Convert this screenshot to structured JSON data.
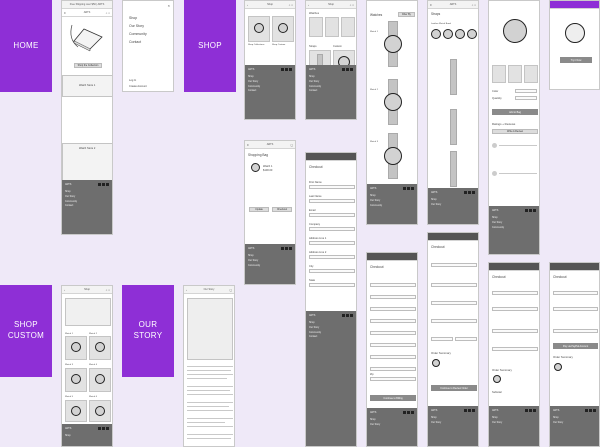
{
  "sections": {
    "home": "HOME",
    "shop": "SHOP",
    "shop_custom": "SHOP\nCUSTOM",
    "our_story": "OUR\nSTORY"
  },
  "nav_menu": [
    "Shop",
    "Our Story",
    "Community",
    "Contact"
  ],
  "footer_links": [
    "Shop",
    "Our Story",
    "Community",
    "Contact"
  ],
  "screens": {
    "home": {
      "header": "Free Shipping over $50 | ARTS",
      "cta": "Shop the Collection",
      "watch_text": "Watch Store 1",
      "watch_text2": "Watch Store 2",
      "login": "Log In",
      "create": "Create Account"
    },
    "shop": {
      "title": "Shop",
      "items": [
        "Shop Collections",
        "Shop Custom"
      ],
      "subitems": [
        "Watches",
        "Straps",
        "Custom"
      ]
    },
    "cart": {
      "title": "Shopping Bag",
      "item": "Watch 1",
      "price": "$100.00",
      "btn1": "Update",
      "btn2": "Checkout"
    },
    "watches": {
      "title": "Watches",
      "filter": "Filter By",
      "items": [
        "Watch 1",
        "Watch 2",
        "Watch 3"
      ]
    },
    "straps": {
      "title": "Straps",
      "subtitle": "Leather Watch Band"
    },
    "product": {
      "title": "Watch 1",
      "price": "$100.00",
      "labels": [
        "Color",
        "Quantity"
      ],
      "btn": "Add to Bag",
      "reviews": "Ratings + Reviews",
      "review_btn": "Write A Review"
    },
    "checkout": {
      "title": "Checkout",
      "fields": [
        "First Name",
        "Last Name",
        "Email",
        "Company",
        "Address Line 1",
        "Address Line 2",
        "City",
        "State",
        "Zip"
      ],
      "btn": "Continue to Billing",
      "order_summary": "Order Summary",
      "subtotal": "Subtotal",
      "pay_btn": "Continue to Review Order",
      "paypal": "Pay via PayPal Account"
    },
    "custom": {
      "title": "Shop",
      "items": [
        "Watch 1",
        "Watch 2",
        "Watch 3",
        "Watch 4",
        "Watch 5",
        "Watch 6"
      ]
    },
    "story": {
      "title": "Our Story"
    },
    "try": {
      "btn": "Try it Now"
    }
  }
}
